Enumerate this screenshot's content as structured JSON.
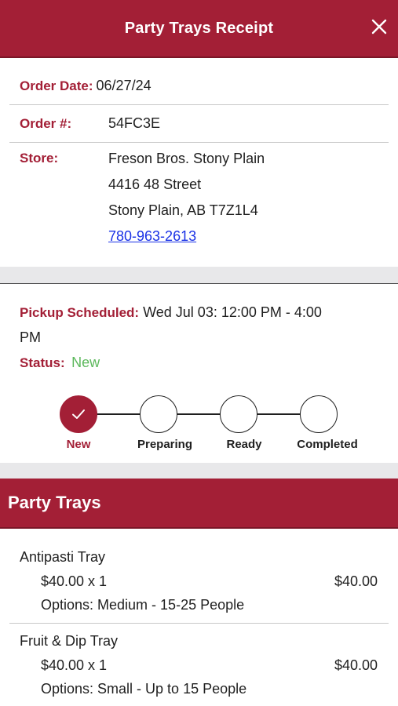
{
  "header": {
    "title": "Party Trays Receipt"
  },
  "order": {
    "date_label": "Order Date:",
    "date": "06/27/24",
    "number_label": "Order #:",
    "number": "54FC3E",
    "store_label": "Store:",
    "store_name": "Freson Bros. Stony Plain",
    "store_street": "4416 48 Street",
    "store_city": "Stony Plain, AB T7Z1L4",
    "store_phone": "780-963-2613"
  },
  "pickup": {
    "label": "Pickup Scheduled:",
    "line1": "Wed Jul 03: 12:00 PM - 4:00",
    "line2": "PM",
    "status_label": "Status:",
    "status": "New",
    "status_color": "#5cb85c"
  },
  "steps": [
    {
      "label": "New",
      "active": true
    },
    {
      "label": "Preparing",
      "active": false
    },
    {
      "label": "Ready",
      "active": false
    },
    {
      "label": "Completed",
      "active": false
    }
  ],
  "section": {
    "title": "Party Trays"
  },
  "items": [
    {
      "name": "Antipasti Tray",
      "qty": "$40.00 x 1",
      "total": "$40.00",
      "options": "Options: Medium - 15-25 People"
    },
    {
      "name": "Fruit & Dip Tray",
      "qty": "$40.00 x 1",
      "total": "$40.00",
      "options": "Options: Small - Up to 15 People"
    }
  ],
  "colors": {
    "brand": "#a31f36",
    "link": "#1a32e6"
  }
}
